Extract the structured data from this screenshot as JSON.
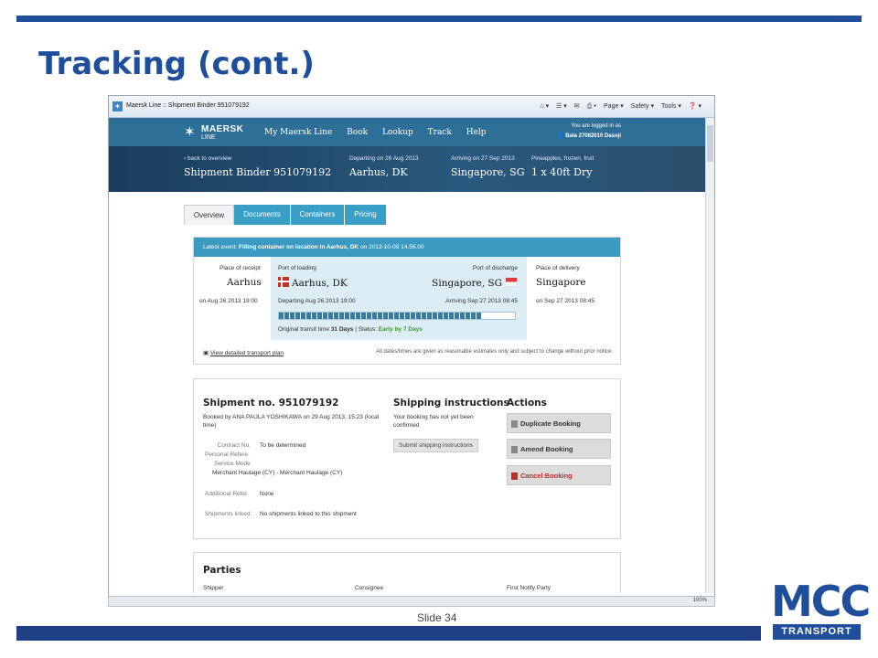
{
  "slide": {
    "title": "Tracking (cont.)",
    "number": "Slide 34",
    "logo_main": "MCC",
    "logo_sub": "TRANSPORT"
  },
  "browser": {
    "tab_title": "Maersk Line :: Shipment Binder 951079192",
    "commands": [
      "Page ▾",
      "Safety ▾",
      "Tools ▾"
    ],
    "zoom": "100%"
  },
  "nav": {
    "logo_line1": "MAERSK",
    "logo_line2": "LINE",
    "items": [
      "My Maersk Line",
      "Book",
      "Lookup",
      "Track",
      "Help"
    ],
    "logged_in_label": "You are logged in as",
    "user": "Bala 27082010 Dasoji"
  },
  "hero": {
    "back": "‹ back to overview",
    "binder": "Shipment Binder 951079192",
    "departing_label": "Departing on 26 Aug 2013",
    "departing_city": "Aarhus, DK",
    "arriving_label": "Arriving on 27 Sep 2013",
    "arriving_city": "Singapore, SG",
    "cargo_label": "Pineapples, frozen, fruit",
    "cargo": "1 x 40ft Dry"
  },
  "tabs": [
    "Overview",
    "Documents",
    "Containers",
    "Pricing"
  ],
  "route": {
    "latest_event_prefix": "Latest event:",
    "latest_event": "Filling container on location in Aarhus, DK",
    "latest_event_time": "on 2013-10-09 14.56.00",
    "receipt_label": "Place of receipt",
    "receipt": "Aarhus",
    "receipt_date": "on Aug 26 2013 19:00",
    "loading_label": "Port of loading",
    "loading": "Aarhus, DK",
    "discharge_label": "Port of discharge",
    "discharge": "Singapore, SG",
    "departing": "Departing Aug 26 2013 19:00",
    "arriving": "Arriving Sep 27 2013 08:45",
    "progress": 0.86,
    "transit": "Original transit time",
    "transit_days": "31 Days",
    "status_label": "| Status:",
    "status": "Early by 7 Days",
    "delivery_label": "Place of delivery",
    "delivery": "Singapore",
    "delivery_date": "on Sep 27 2013 08:45",
    "plan_link": "View detailed transport plan",
    "disclaimer": "All dates/times are given as reasonable estimates only and subject to change without prior notice."
  },
  "shipment": {
    "title": "Shipment no. 951079192",
    "booked_by": "Booked by ANA PAULA YOSHIKAWA on 29 Aug 2013, 15:23 (local time)",
    "contract_label": "Contract No.",
    "contract": "To be determined",
    "personal_ref_label": "Personal Refere.",
    "service_mode_label": "Service Mode",
    "service_mode": "Merchant Haulage (CY) - Merchant Haulage (CY)",
    "additional_ref_label": "Additional Refer.",
    "additional_ref": "None",
    "linked_label": "Shipments linked:",
    "linked": "No shipments linked to this shipment"
  },
  "instructions": {
    "title": "Shipping instructions",
    "text": "Your booking has not yet been confirmed",
    "button": "Submit shipping instructions"
  },
  "actions": {
    "title": "Actions",
    "duplicate": "Duplicate Booking",
    "amend": "Amend Booking",
    "cancel": "Cancel Booking"
  },
  "parties": {
    "title": "Parties",
    "shipper": "Shipper",
    "consignee": "Consignee",
    "notify": "First Notify Party"
  },
  "colors": {
    "brand_blue": "#1f4e9a",
    "maersk_blue": "#2e6f97",
    "tab_blue": "#3a9fc7",
    "status_green": "#3a9a2a",
    "cancel_red": "#c0302b"
  }
}
